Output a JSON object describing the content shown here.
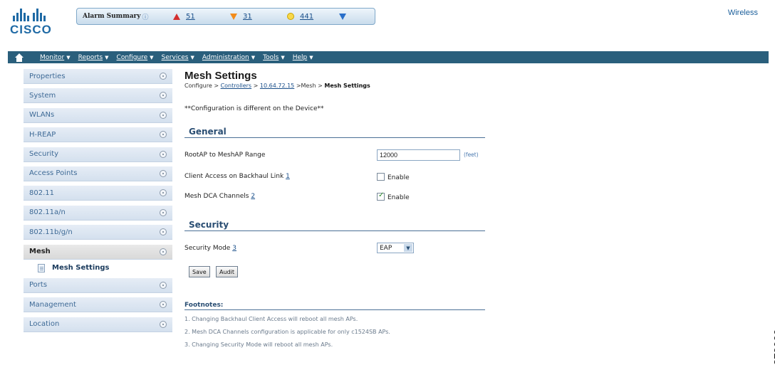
{
  "header": {
    "logo_text": "CISCO",
    "alarm_summary": {
      "label": "Alarm Summary",
      "critical": "51",
      "major": "31",
      "minor": "441"
    },
    "product": "Wireless"
  },
  "nav": {
    "items": [
      {
        "label": "Monitor"
      },
      {
        "label": "Reports"
      },
      {
        "label": "Configure"
      },
      {
        "label": "Services"
      },
      {
        "label": "Administration"
      },
      {
        "label": "Tools"
      },
      {
        "label": "Help"
      }
    ]
  },
  "sidebar": {
    "items": [
      {
        "label": "Properties"
      },
      {
        "label": "System"
      },
      {
        "label": "WLANs"
      },
      {
        "label": "H-REAP"
      },
      {
        "label": "Security"
      },
      {
        "label": "Access Points"
      },
      {
        "label": "802.11"
      },
      {
        "label": "802.11a/n"
      },
      {
        "label": "802.11b/g/n"
      },
      {
        "label": "Mesh"
      },
      {
        "label": "Ports"
      },
      {
        "label": "Management"
      },
      {
        "label": "Location"
      }
    ],
    "sub_item": "Mesh Settings"
  },
  "main": {
    "title": "Mesh Settings",
    "breadcrumb": {
      "configure": "Configure",
      "sep": ">",
      "controllers": "Controllers",
      "ip": "10.64.72.15",
      "mesh": ">Mesh",
      "current": "Mesh Settings"
    },
    "config_note": "**Configuration is different on the Device**",
    "general": {
      "heading": "General",
      "range_label": "RootAP to MeshAP Range",
      "range_value": "12000",
      "range_unit": "(feet)",
      "client_access_label": "Client Access on Backhaul Link",
      "client_access_ref": "1",
      "client_access_checked": false,
      "dca_label": "Mesh DCA Channels",
      "dca_ref": "2",
      "dca_checked": true,
      "enable_label": "Enable"
    },
    "security": {
      "heading": "Security",
      "mode_label": "Security Mode",
      "mode_ref": "3",
      "mode_value": "EAP"
    },
    "buttons": {
      "save": "Save",
      "audit": "Audit"
    },
    "footnotes": {
      "heading": "Footnotes:",
      "items": [
        "1. Changing Backhaul Client Access will reboot all mesh APs.",
        "2. Mesh DCA Channels configuration is applicable for only c1524SB APs.",
        "3. Changing Security Mode will reboot all mesh APs."
      ]
    }
  },
  "figure_id": "279066"
}
